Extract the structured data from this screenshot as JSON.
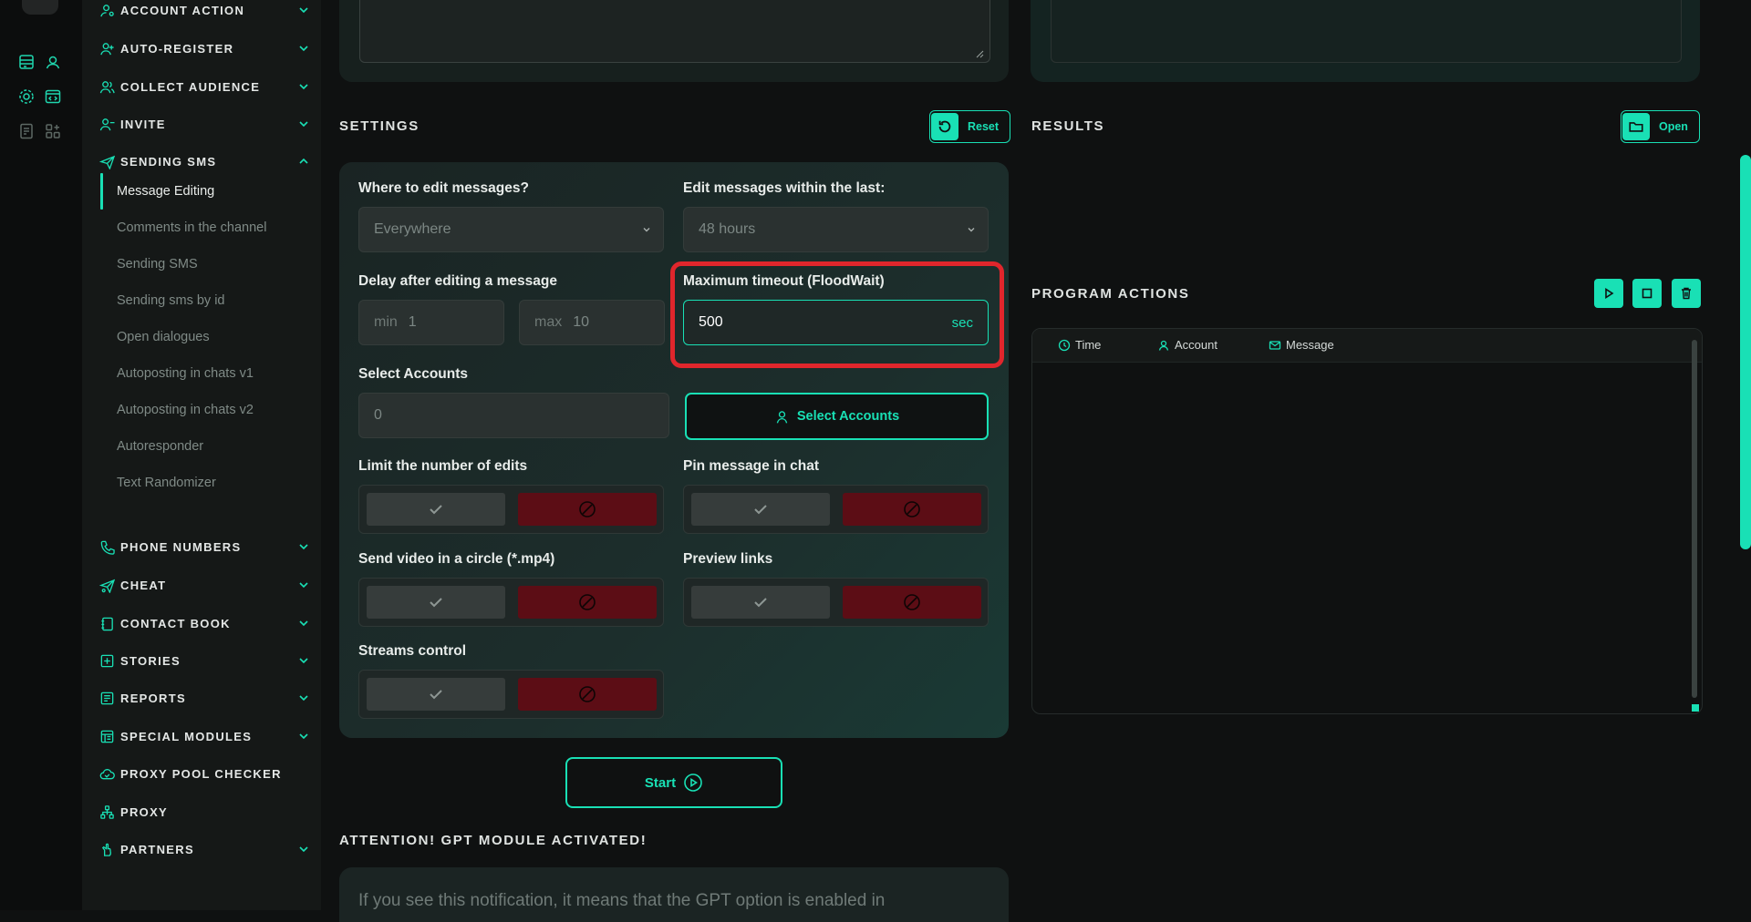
{
  "sidebar": {
    "items": [
      {
        "label": "ACCOUNT ACTION",
        "icon": "user-gear-icon"
      },
      {
        "label": "AUTO-REGISTER",
        "icon": "user-plus-icon"
      },
      {
        "label": "COLLECT AUDIENCE",
        "icon": "users-icon"
      },
      {
        "label": "INVITE",
        "icon": "user-invite-icon"
      },
      {
        "label": "SENDING SMS",
        "icon": "paper-plane-icon"
      },
      {
        "label": "PHONE NUMBERS",
        "icon": "phone-icon"
      },
      {
        "label": "CHEAT",
        "icon": "send-cheat-icon"
      },
      {
        "label": "CONTACT BOOK",
        "icon": "book-icon"
      },
      {
        "label": "STORIES",
        "icon": "plus-square-icon"
      },
      {
        "label": "REPORTS",
        "icon": "report-icon"
      },
      {
        "label": "SPECIAL MODULES",
        "icon": "modules-icon"
      },
      {
        "label": "PROXY POOL CHECKER",
        "icon": "cloud-check-icon"
      },
      {
        "label": "PROXY",
        "icon": "network-icon"
      },
      {
        "label": "PARTNERS",
        "icon": "handshake-icon"
      }
    ],
    "sub_items": [
      "Message Editing",
      "Comments in the channel",
      "Sending SMS",
      "Sending sms by id",
      "Open dialogues",
      "Autoposting in chats v1",
      "Autoposting in chats v2",
      "Autoresponder",
      "Text Randomizer"
    ],
    "active_sub": "Message Editing"
  },
  "settings": {
    "title": "SETTINGS",
    "reset_label": "Reset",
    "where_label": "Where to edit messages?",
    "where_value": "Everywhere",
    "within_label": "Edit messages within the last:",
    "within_value": "48 hours",
    "delay_label": "Delay after editing a message",
    "delay_min_prefix": "min",
    "delay_min": "1",
    "delay_max_prefix": "max",
    "delay_max": "10",
    "timeout_label": "Maximum timeout (FloodWait)",
    "timeout_value": "500",
    "timeout_unit": "sec",
    "accounts_label": "Select Accounts",
    "accounts_value": "0",
    "select_accounts_button": "Select Accounts",
    "limit_label": "Limit the number of edits",
    "pin_label": "Pin message in chat",
    "video_label": "Send video in a circle (*.mp4)",
    "preview_label": "Preview links",
    "streams_label": "Streams control",
    "start_label": "Start"
  },
  "results": {
    "title": "RESULTS",
    "open_label": "Open"
  },
  "program_actions": {
    "title": "PROGRAM ACTIONS",
    "columns": [
      "Time",
      "Account",
      "Message"
    ]
  },
  "gpt": {
    "title": "ATTENTION! GPT MODULE ACTIVATED!",
    "text": "If you see this notification, it means that the GPT option is enabled in"
  },
  "colors": {
    "accent": "#19e0b5",
    "highlight": "#e0262c",
    "danger": "#5c0d15"
  }
}
